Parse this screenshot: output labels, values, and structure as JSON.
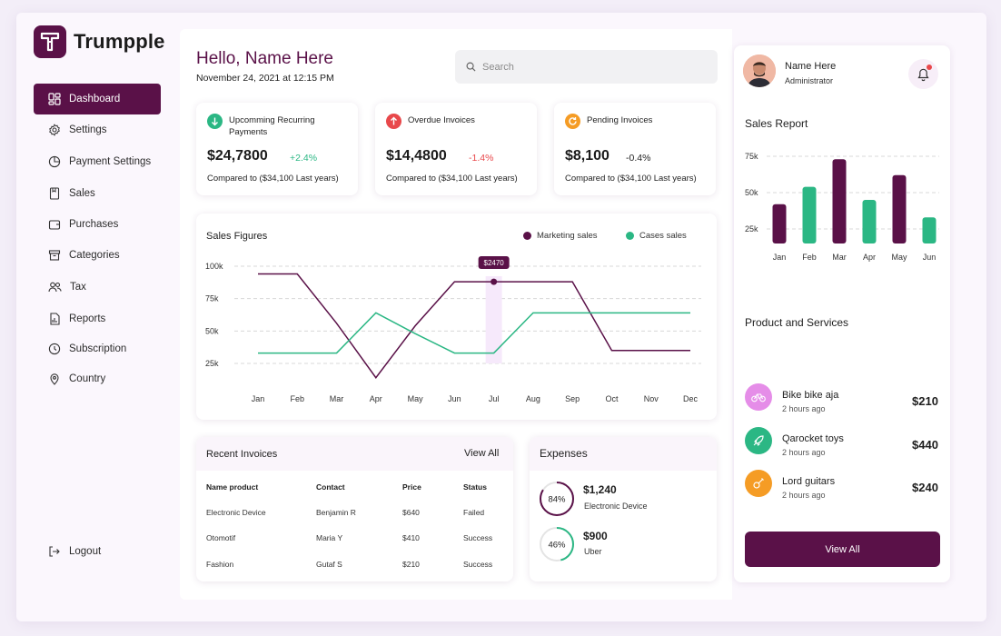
{
  "brand": {
    "name": "Trumpple"
  },
  "colors": {
    "primary": "#5a1148",
    "green": "#2bb784",
    "red": "#e8484b",
    "orange": "#f59c25",
    "marketing": "#5a1148",
    "cases": "#2bb784"
  },
  "sidebar": {
    "items": [
      {
        "label": "Dashboard",
        "icon": "dashboard-icon",
        "active": true
      },
      {
        "label": "Settings",
        "icon": "gear-icon"
      },
      {
        "label": "Payment Settings",
        "icon": "pie-chart-icon"
      },
      {
        "label": "Sales",
        "icon": "bookmark-icon"
      },
      {
        "label": "Purchases",
        "icon": "wallet-icon"
      },
      {
        "label": "Categories",
        "icon": "archive-icon"
      },
      {
        "label": "Tax",
        "icon": "users-icon"
      },
      {
        "label": "Reports",
        "icon": "report-icon"
      },
      {
        "label": "Subscription",
        "icon": "subscription-icon"
      },
      {
        "label": "Country",
        "icon": "location-pin-icon"
      }
    ],
    "logout": "Logout"
  },
  "header": {
    "greeting": "Hello, Name Here",
    "date": "November 24, 2021 at 12:15 PM",
    "search_placeholder": "Search"
  },
  "stats": [
    {
      "title": "Upcomming Recurring Payments",
      "value": "$24,7800",
      "change": "+2.4%",
      "compare": "Compared to ($34,100 Last years)",
      "icon": "arrow-down-icon"
    },
    {
      "title": "Overdue Invoices",
      "value": "$14,4800",
      "change": "-1.4%",
      "compare": "Compared to ($34,100 Last years)",
      "icon": "arrow-up-icon"
    },
    {
      "title": "Pending Invoices",
      "value": "$8,100",
      "change": "-0.4%",
      "compare": "Compared to ($34,100 Last years)",
      "icon": "refresh-icon"
    }
  ],
  "sales_figures": {
    "title": "Sales Figures",
    "tooltip": "$2470",
    "legend": [
      "Marketing sales",
      "Cases sales"
    ]
  },
  "recent_invoices": {
    "title": "Recent Invoices",
    "view_all": "View All",
    "columns": [
      "Name product",
      "Contact",
      "Price",
      "Status"
    ],
    "rows": [
      [
        "Electronic Device",
        "Benjamin R",
        "$640",
        "Failed"
      ],
      [
        "Otomotif",
        "Maria Y",
        "$410",
        "Success"
      ],
      [
        "Fashion",
        "Gutaf S",
        "$210",
        "Success"
      ]
    ]
  },
  "expenses": {
    "title": "Expenses",
    "items": [
      {
        "percent": "84%",
        "percent_value": 84,
        "amount": "$1,240",
        "label": "Electronic Device"
      },
      {
        "percent": "46%",
        "percent_value": 46,
        "amount": "$900",
        "label": "Uber"
      }
    ]
  },
  "profile": {
    "name": "Name Here",
    "role": "Administrator"
  },
  "product_services": {
    "title": "Product and Services",
    "items": [
      {
        "name": "Bike bike aja",
        "time": "2 hours ago",
        "price": "$210",
        "icon": "bike-icon",
        "color": "#e58de8"
      },
      {
        "name": "Qarocket toys",
        "time": "2 hours ago",
        "price": "$440",
        "icon": "rocket-icon",
        "color": "#2bb784"
      },
      {
        "name": "Lord guitars",
        "time": "2 hours ago",
        "price": "$240",
        "icon": "guitar-icon",
        "color": "#f59c25"
      }
    ],
    "view_all": "View All"
  },
  "chart_data": [
    {
      "type": "line",
      "title": "Sales Figures",
      "x": [
        "Jan",
        "Feb",
        "Mar",
        "Apr",
        "May",
        "Jun",
        "Jul",
        "Aug",
        "Sep",
        "Oct",
        "Nov",
        "Dec"
      ],
      "y_ticks": [
        "100k",
        "75k",
        "50k",
        "25k"
      ],
      "ylim": [
        25000,
        100000
      ],
      "grid": true,
      "legend_position": "top-right",
      "series": [
        {
          "name": "Marketing sales",
          "color": "#5a1148",
          "values": [
            94000,
            94000,
            56000,
            14000,
            54000,
            88000,
            88000,
            88000,
            88000,
            35000,
            35000,
            35000
          ]
        },
        {
          "name": "Cases sales",
          "color": "#2bb784",
          "values": [
            33000,
            33000,
            33000,
            64000,
            48000,
            33000,
            33000,
            64000,
            64000,
            64000,
            64000,
            64000
          ]
        }
      ],
      "highlight": {
        "x": "Jul",
        "value": 2470,
        "label": "$2470"
      }
    },
    {
      "type": "bar",
      "title": "Sales Report",
      "categories": [
        "Jan",
        "Feb",
        "Mar",
        "Apr",
        "May",
        "Jun"
      ],
      "y_ticks": [
        "75k",
        "50k",
        "25k"
      ],
      "ylim": [
        15000,
        75000
      ],
      "grid": true,
      "values": [
        42000,
        54000,
        73000,
        45000,
        62000,
        33000
      ],
      "colors": [
        "#5a1148",
        "#2bb784",
        "#5a1148",
        "#2bb784",
        "#5a1148",
        "#2bb784"
      ]
    }
  ]
}
